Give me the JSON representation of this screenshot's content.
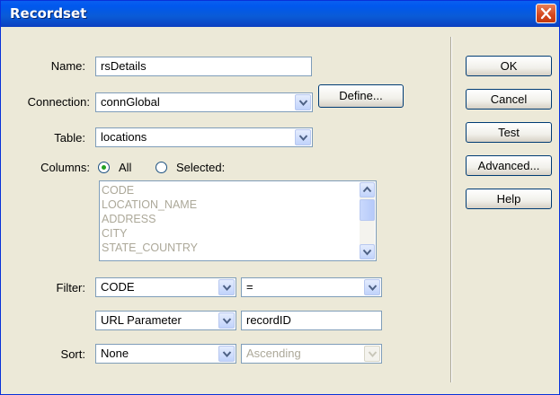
{
  "window": {
    "title": "Recordset"
  },
  "form": {
    "name_label": "Name:",
    "name_value": "rsDetails",
    "connection_label": "Connection:",
    "connection_value": "connGlobal",
    "define_label": "Define...",
    "table_label": "Table:",
    "table_value": "locations",
    "columns_label": "Columns:",
    "columns_all_label": "All",
    "columns_selected_label": "Selected:",
    "columns_selected_option": "All",
    "column_items": [
      "CODE",
      "LOCATION_NAME",
      "ADDRESS",
      "CITY",
      "STATE_COUNTRY"
    ],
    "filter_label": "Filter:",
    "filter_column": "CODE",
    "filter_operator": "=",
    "filter_source": "URL Parameter",
    "filter_value": "recordID",
    "sort_label": "Sort:",
    "sort_column": "None",
    "sort_order": "Ascending"
  },
  "buttons": {
    "ok": "OK",
    "cancel": "Cancel",
    "test": "Test",
    "advanced": "Advanced...",
    "help": "Help"
  },
  "icons": {
    "close": "close-icon",
    "dropdown": "chevron-down-icon",
    "scroll_up": "arrow-up-icon",
    "scroll_down": "arrow-down-icon"
  },
  "colors": {
    "titlebar": "#0058ee",
    "close": "#d4461c",
    "dialog_bg": "#ece9d8"
  }
}
